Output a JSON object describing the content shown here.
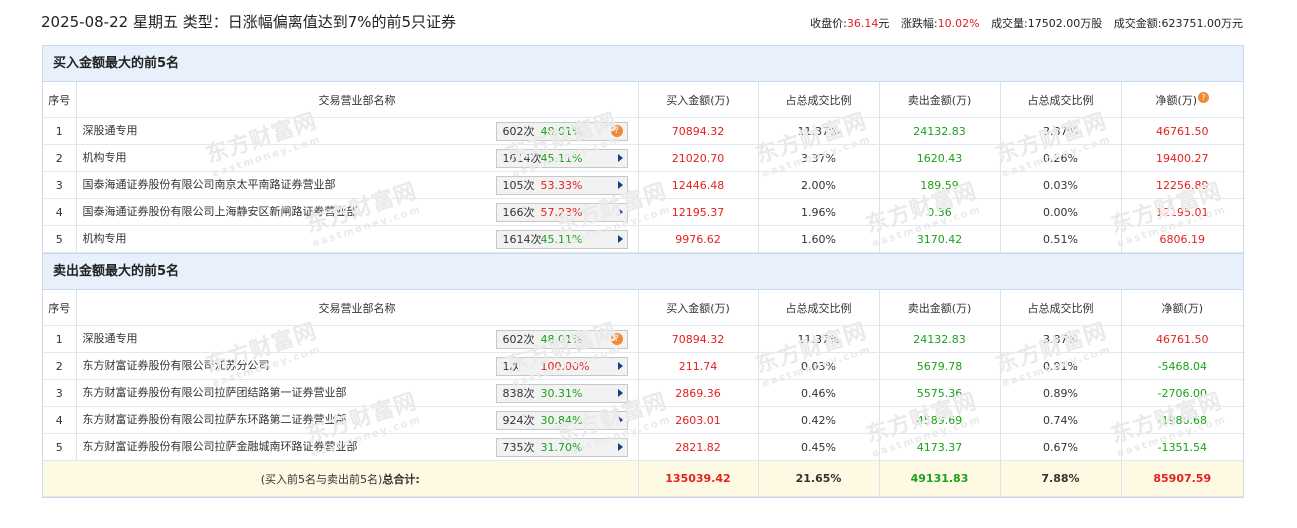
{
  "header": {
    "title": "2025-08-22 星期五 类型：日涨幅偏离值达到7%的前5只证券",
    "close_label": "收盘价:",
    "close_value": "36.14",
    "close_unit": "元",
    "change_label": "涨跌幅:",
    "change_value": "10.02%",
    "volume_label": "成交量:",
    "volume_value": "17502.00万股",
    "amount_label": "成交金额:",
    "amount_value": "623751.00万元"
  },
  "columns": {
    "idx": "序号",
    "name": "交易营业部名称",
    "buy": "买入金额(万)",
    "buy_pct": "占总成交比例",
    "sell": "卖出金额(万)",
    "sell_pct": "占总成交比例",
    "net": "净额(万)"
  },
  "buy_section": {
    "title": "买入金额最大的前5名",
    "rows": [
      {
        "idx": "1",
        "name": "深股通专用",
        "count": "602次",
        "rate": "48.01%",
        "rate_color": "green",
        "tag": "question",
        "buy": "70894.32",
        "buy_pct": "11.37%",
        "sell": "24132.83",
        "sell_pct": "3.87%",
        "net": "46761.50"
      },
      {
        "idx": "2",
        "name": "机构专用",
        "count": "1614次",
        "rate": "45.11%",
        "rate_color": "green",
        "tag": "arrow",
        "buy": "21020.70",
        "buy_pct": "3.37%",
        "sell": "1620.43",
        "sell_pct": "0.26%",
        "net": "19400.27"
      },
      {
        "idx": "3",
        "name": "国泰海通证券股份有限公司南京太平南路证券营业部",
        "count": "105次",
        "rate": "53.33%",
        "rate_color": "red",
        "tag": "arrow",
        "buy": "12446.48",
        "buy_pct": "2.00%",
        "sell": "189.59",
        "sell_pct": "0.03%",
        "net": "12256.89"
      },
      {
        "idx": "4",
        "name": "国泰海通证券股份有限公司上海静安区新闸路证券营业部",
        "count": "166次",
        "rate": "57.23%",
        "rate_color": "red",
        "tag": "arrow",
        "buy": "12195.37",
        "buy_pct": "1.96%",
        "sell": "0.36",
        "sell_pct": "0.00%",
        "net": "12195.01"
      },
      {
        "idx": "5",
        "name": "机构专用",
        "count": "1614次",
        "rate": "45.11%",
        "rate_color": "green",
        "tag": "arrow",
        "buy": "9976.62",
        "buy_pct": "1.60%",
        "sell": "3170.42",
        "sell_pct": "0.51%",
        "net": "6806.19"
      }
    ]
  },
  "sell_section": {
    "title": "卖出金额最大的前5名",
    "rows": [
      {
        "idx": "1",
        "name": "深股通专用",
        "count": "602次",
        "rate": "48.01%",
        "rate_color": "green",
        "tag": "question",
        "buy": "70894.32",
        "buy_pct": "11.37%",
        "sell": "24132.83",
        "sell_pct": "3.87%",
        "net": "46761.50",
        "net_color": "red"
      },
      {
        "idx": "2",
        "name": "东方财富证券股份有限公司江苏分公司",
        "count": "1次",
        "rate": "100.00%",
        "rate_color": "red",
        "tag": "arrow",
        "buy": "211.74",
        "buy_pct": "0.03%",
        "sell": "5679.78",
        "sell_pct": "0.91%",
        "net": "-5468.04",
        "net_color": "green"
      },
      {
        "idx": "3",
        "name": "东方财富证券股份有限公司拉萨团结路第一证券营业部",
        "count": "838次",
        "rate": "30.31%",
        "rate_color": "green",
        "tag": "arrow",
        "buy": "2869.36",
        "buy_pct": "0.46%",
        "sell": "5575.36",
        "sell_pct": "0.89%",
        "net": "-2706.00",
        "net_color": "green"
      },
      {
        "idx": "4",
        "name": "东方财富证券股份有限公司拉萨东环路第二证券营业部",
        "count": "924次",
        "rate": "30.84%",
        "rate_color": "green",
        "tag": "arrow",
        "buy": "2603.01",
        "buy_pct": "0.42%",
        "sell": "4589.69",
        "sell_pct": "0.74%",
        "net": "-1986.68",
        "net_color": "green"
      },
      {
        "idx": "5",
        "name": "东方财富证券股份有限公司拉萨金融城南环路证券营业部",
        "count": "735次",
        "rate": "31.70%",
        "rate_color": "green",
        "tag": "arrow",
        "buy": "2821.82",
        "buy_pct": "0.45%",
        "sell": "4173.37",
        "sell_pct": "0.67%",
        "net": "-1351.54",
        "net_color": "green"
      }
    ]
  },
  "total": {
    "label_prefix": "(买入前5名与卖出前5名)",
    "label_bold": "总合计:",
    "buy": "135039.42",
    "buy_pct": "21.65%",
    "sell": "49131.83",
    "sell_pct": "7.88%",
    "net": "85907.59"
  },
  "watermark": {
    "cn": "东方财富网",
    "en": "eastmoney.com"
  },
  "colors": {
    "red": "#e4201f",
    "green": "#1aa11a",
    "section_bg": "#e7f0fb",
    "total_bg": "#fdf9e3"
  }
}
